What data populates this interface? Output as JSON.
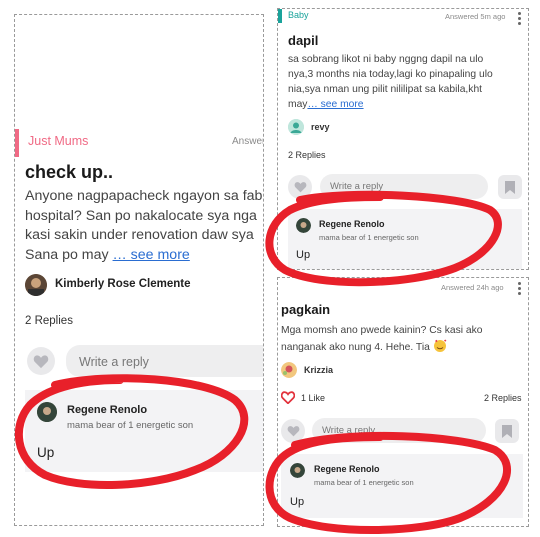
{
  "left": {
    "category": "Just Mums",
    "answered": "Answer",
    "title": "check up..",
    "body": "Anyone nagpapacheck ngayon sa fab\nhospital? San po nakalocate sya nga\nkasi sakin under renovation daw sya\nSana po may ",
    "see_more": "… see more",
    "author": "Kimberly Rose Clemente",
    "replies": "2 Replies",
    "reply_placeholder": "Write a reply",
    "comment": {
      "name": "Regene Renolo",
      "subtitle": "mama bear of 1 energetic son",
      "text": "Up"
    }
  },
  "top_right": {
    "category": "Baby",
    "answered": "Answered 5m ago",
    "title": "dapil",
    "body": "sa sobrang likot ni baby nggng dapil na ulo\nnya,3 months nia today,lagi ko pinapaling ulo\nnia,sya nman ung pilit nililipat sa kabila,kht\nmay",
    "see_more": "… see more",
    "author": "revy",
    "replies": "2 Replies",
    "reply_placeholder": "Write a reply",
    "comment": {
      "name": "Regene Renolo",
      "subtitle": "mama bear of 1 energetic son",
      "text": "Up"
    }
  },
  "bottom_right": {
    "answered": "Answered 24h ago",
    "title": "pagkain",
    "body": "Mga momsh ano pwede kainin? Cs kasi ako\nnanganak ako nung 4. Hehe. Tia ",
    "author": "Krizzia",
    "likes": "1 Like",
    "replies": "2 Replies",
    "reply_placeholder": "Write a reply",
    "comment": {
      "name": "Regene Renolo",
      "subtitle": "mama bear of 1 energetic son",
      "text": "Up"
    }
  },
  "colors": {
    "accent_pink": "#f06a85",
    "accent_teal": "#1aa39b",
    "link": "#2a6dd1",
    "scribble": "#e8202a"
  }
}
